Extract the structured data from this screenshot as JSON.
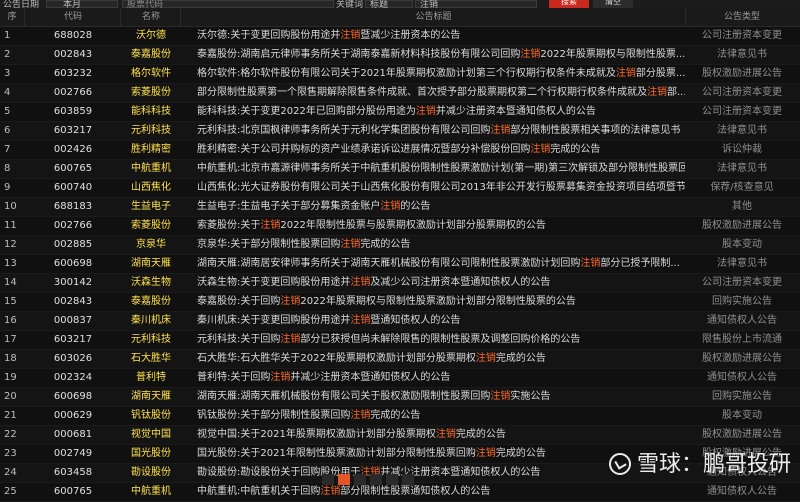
{
  "filter": {
    "date_label": "公告日期",
    "period_value": "本月",
    "stock_label": "股票代码",
    "keyword_label": "关键词",
    "keyword_field": "标题",
    "keyword_value": "注销",
    "search_label": "搜索",
    "clear_label": "清空"
  },
  "table": {
    "headers": {
      "seq": "序",
      "code": "代码",
      "name": "名称",
      "title": "公告标题",
      "type": "公告类型"
    },
    "highlight_color": "#ff6a2a",
    "rows": [
      {
        "seq": "1",
        "code": "688028",
        "name": "沃尔德",
        "pre": "沃尔德:关于变更回购股份用途并",
        "hl": "注销",
        "post": "暨减少注册资本的公告",
        "type": "公司注册资本变更"
      },
      {
        "seq": "2",
        "code": "002843",
        "name": "泰嘉股份",
        "pre": "泰嘉股份:湖南启元律师事务所关于湖南泰嘉新材料科技股份有限公司回购",
        "hl": "注销",
        "post": "2022年股票期权与限制性股票...",
        "type": "法律意见书"
      },
      {
        "seq": "3",
        "code": "603232",
        "name": "格尔软件",
        "pre": "格尔软件:格尔软件股份有限公司关于2021年股票期权激励计划第三个行权期行权条件未成就及",
        "hl": "注销",
        "post": "部分股票...",
        "type": "股权激励进展公告"
      },
      {
        "seq": "4",
        "code": "002766",
        "name": "索菱股份",
        "pre": "部分限制性股票第一个限售期解除限售条件成就、首次授予部分股票期权第二个行权期行权条件成就及",
        "hl": "注销",
        "post": "部...",
        "type": "公司注册资本变更"
      },
      {
        "seq": "5",
        "code": "603859",
        "name": "能科科技",
        "pre": "能科科技:关于变更2022年已回购部分股份用途为",
        "hl": "注销",
        "post": "并减少注册资本暨通知债权人的公告",
        "type": "公司注册资本变更"
      },
      {
        "seq": "6",
        "code": "603217",
        "name": "元利科技",
        "pre": "元利科技:北京国枫律师事务所关于元利化学集团股份有限公司回购",
        "hl": "注销",
        "post": "部分限制性股票相关事项的法律意见书",
        "type": "法律意见书"
      },
      {
        "seq": "7",
        "code": "002426",
        "name": "胜利精密",
        "pre": "胜利精密:关于公司并购标的资产业绩承诺诉讼进展情况暨部分补偿股份回购",
        "hl": "注销",
        "post": "完成的公告",
        "type": "诉讼仲裁"
      },
      {
        "seq": "8",
        "code": "600765",
        "name": "中航重机",
        "pre": "中航重机:北京市嘉源律师事务所关于中航重机股份限制性股票激励计划(第一期)第三次解锁及部分限制性股票回...",
        "hl": "",
        "post": "",
        "type": "法律意见书"
      },
      {
        "seq": "9",
        "code": "600740",
        "name": "山西焦化",
        "pre": "山西焦化:光大证券股份有限公司关于山西焦化股份有限公司2013年非公开发行股票募集资金投资项目结项暨节...",
        "hl": "",
        "post": "",
        "type": "保荐/核查意见"
      },
      {
        "seq": "10",
        "code": "688183",
        "name": "生益电子",
        "pre": "生益电子:生益电子关于部分募集资金账户",
        "hl": "注销",
        "post": "的公告",
        "type": "其他"
      },
      {
        "seq": "11",
        "code": "002766",
        "name": "索菱股份",
        "pre": "索菱股份:关于",
        "hl": "注销",
        "post": "2022年限制性股票与股票期权激励计划部分股票期权的公告",
        "type": "股权激励进展公告"
      },
      {
        "seq": "12",
        "code": "002885",
        "name": "京泉华",
        "pre": "京泉华:关于部分限制性股票回购",
        "hl": "注销",
        "post": "完成的公告",
        "type": "股本变动"
      },
      {
        "seq": "13",
        "code": "600698",
        "name": "湖南天雁",
        "pre": "湖南天雁:湖南居安律师事务所关于湖南天雁机械股份有限公司限制性股票激励计划回购",
        "hl": "注销",
        "post": "部分已授予限制...",
        "type": "法律意见书"
      },
      {
        "seq": "14",
        "code": "300142",
        "name": "沃森生物",
        "pre": "沃森生物:关于变更回购股份用途并",
        "hl": "注销",
        "post": "及减少公司注册资本暨通知债权人的公告",
        "type": "公司注册资本变更"
      },
      {
        "seq": "15",
        "code": "002843",
        "name": "泰嘉股份",
        "pre": "泰嘉股份:关于回购",
        "hl": "注销",
        "post": "2022年股票期权与限制性股票激励计划部分限制性股票的公告",
        "type": "回购实施公告"
      },
      {
        "seq": "16",
        "code": "000837",
        "name": "秦川机床",
        "pre": "秦川机床:关于变更回购股份用途并",
        "hl": "注销",
        "post": "暨通知债权人的公告",
        "type": "通知债权人公告"
      },
      {
        "seq": "17",
        "code": "603217",
        "name": "元利科技",
        "pre": "元利科技:关于回购",
        "hl": "注销",
        "post": "部分已获授但尚未解除限售的限制性股票及调整回购价格的公告",
        "type": "限售股份上市流通"
      },
      {
        "seq": "18",
        "code": "603026",
        "name": "石大胜华",
        "pre": "石大胜华:石大胜华关于2022年股票期权激励计划部分股票期权",
        "hl": "注销",
        "post": "完成的公告",
        "type": "股权激励进展公告"
      },
      {
        "seq": "19",
        "code": "002324",
        "name": "普利特",
        "pre": "普利特:关于回购",
        "hl": "注销",
        "post": "并减少注册资本暨通知债权人的公告",
        "type": "通知债权人公告"
      },
      {
        "seq": "20",
        "code": "600698",
        "name": "湖南天雁",
        "pre": "湖南天雁:湖南天雁机械股份有限公司关于股权激励限制性股票回购",
        "hl": "注销",
        "post": "实施公告",
        "type": "回购实施公告"
      },
      {
        "seq": "21",
        "code": "000629",
        "name": "钒钛股份",
        "pre": "钒钛股份:关于部分限制性股票回购",
        "hl": "注销",
        "post": "完成的公告",
        "type": "股本变动"
      },
      {
        "seq": "22",
        "code": "000681",
        "name": "视觉中国",
        "pre": "视觉中国:关于2021年股票期权激励计划部分股票期权",
        "hl": "注销",
        "post": "完成的公告",
        "type": "股权激励进展公告"
      },
      {
        "seq": "23",
        "code": "002749",
        "name": "国光股份",
        "pre": "国光股份:关于2021年限制性股票激励计划部分限制性股票回购",
        "hl": "注销",
        "post": "完成的公告",
        "type": "股权激励进展公告"
      },
      {
        "seq": "24",
        "code": "603458",
        "name": "勘设股份",
        "pre": "勘设股份:勘设股份关于回购股份用于",
        "hl": "注销",
        "post": "并减少注册资本暨通知债权人的公告",
        "type": "通知债权人公告"
      },
      {
        "seq": "25",
        "code": "600765",
        "name": "中航重机",
        "pre": "中航重机:中航重机关于回购",
        "hl": "注销",
        "post": "部分限制性股票通知债权人的公告",
        "type": "通知债权人公告"
      }
    ]
  },
  "watermark": {
    "text": "雪球：鹏哥投研",
    "icon": "snowball-logo-icon"
  }
}
